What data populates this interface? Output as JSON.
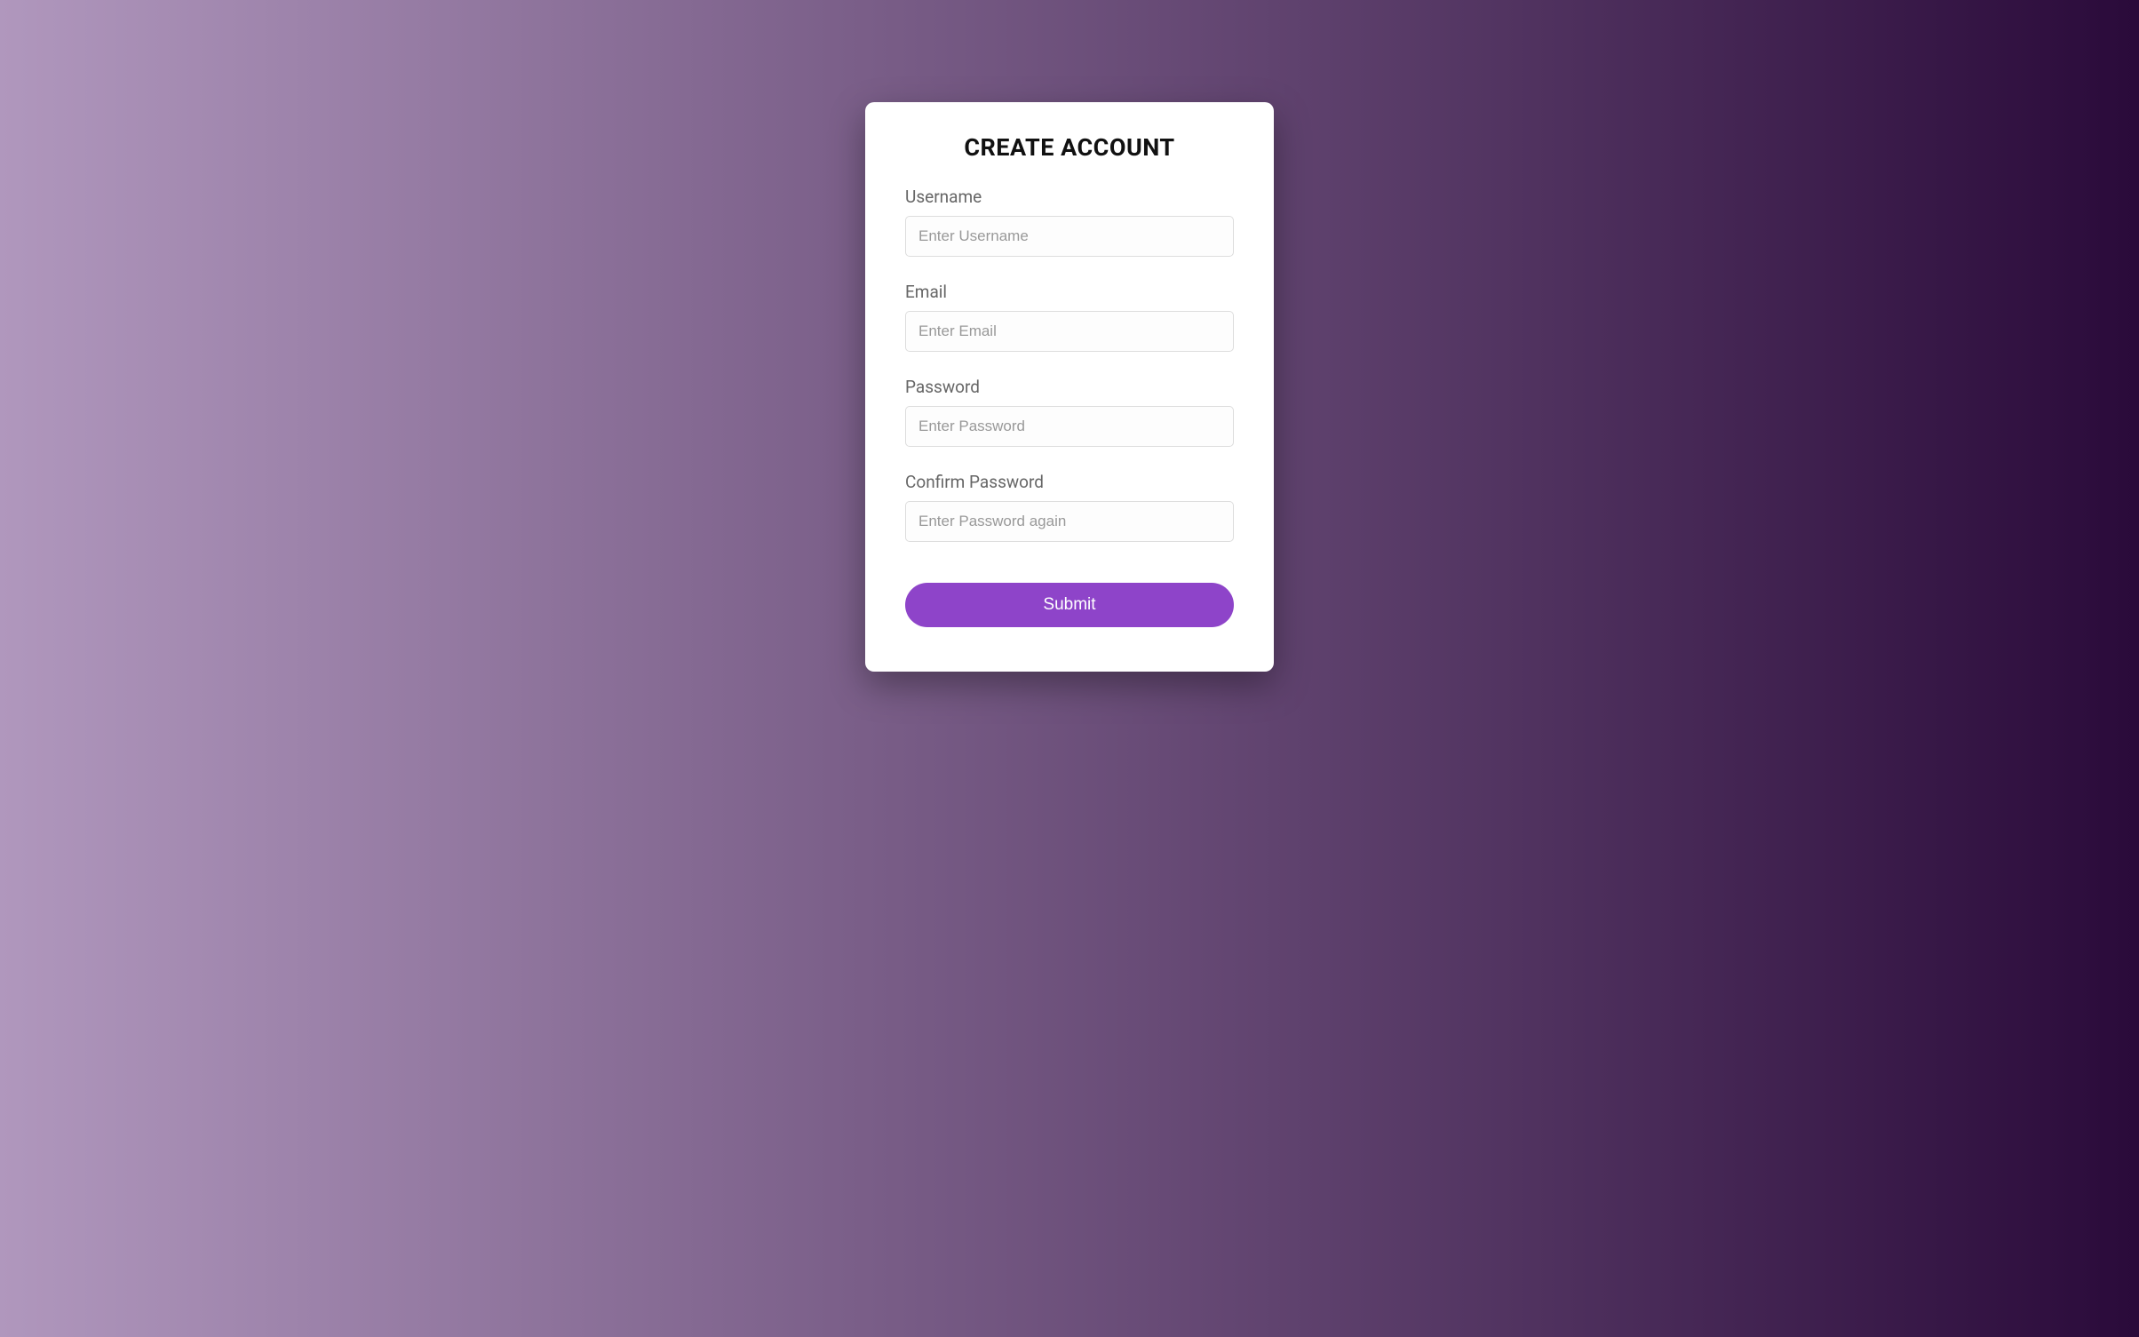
{
  "form": {
    "title": "CREATE ACCOUNT",
    "fields": {
      "username": {
        "label": "Username",
        "placeholder": "Enter Username"
      },
      "email": {
        "label": "Email",
        "placeholder": "Enter Email"
      },
      "password": {
        "label": "Password",
        "placeholder": "Enter Password"
      },
      "confirm_password": {
        "label": "Confirm Password",
        "placeholder": "Enter Password again"
      }
    },
    "submit_label": "Submit"
  }
}
